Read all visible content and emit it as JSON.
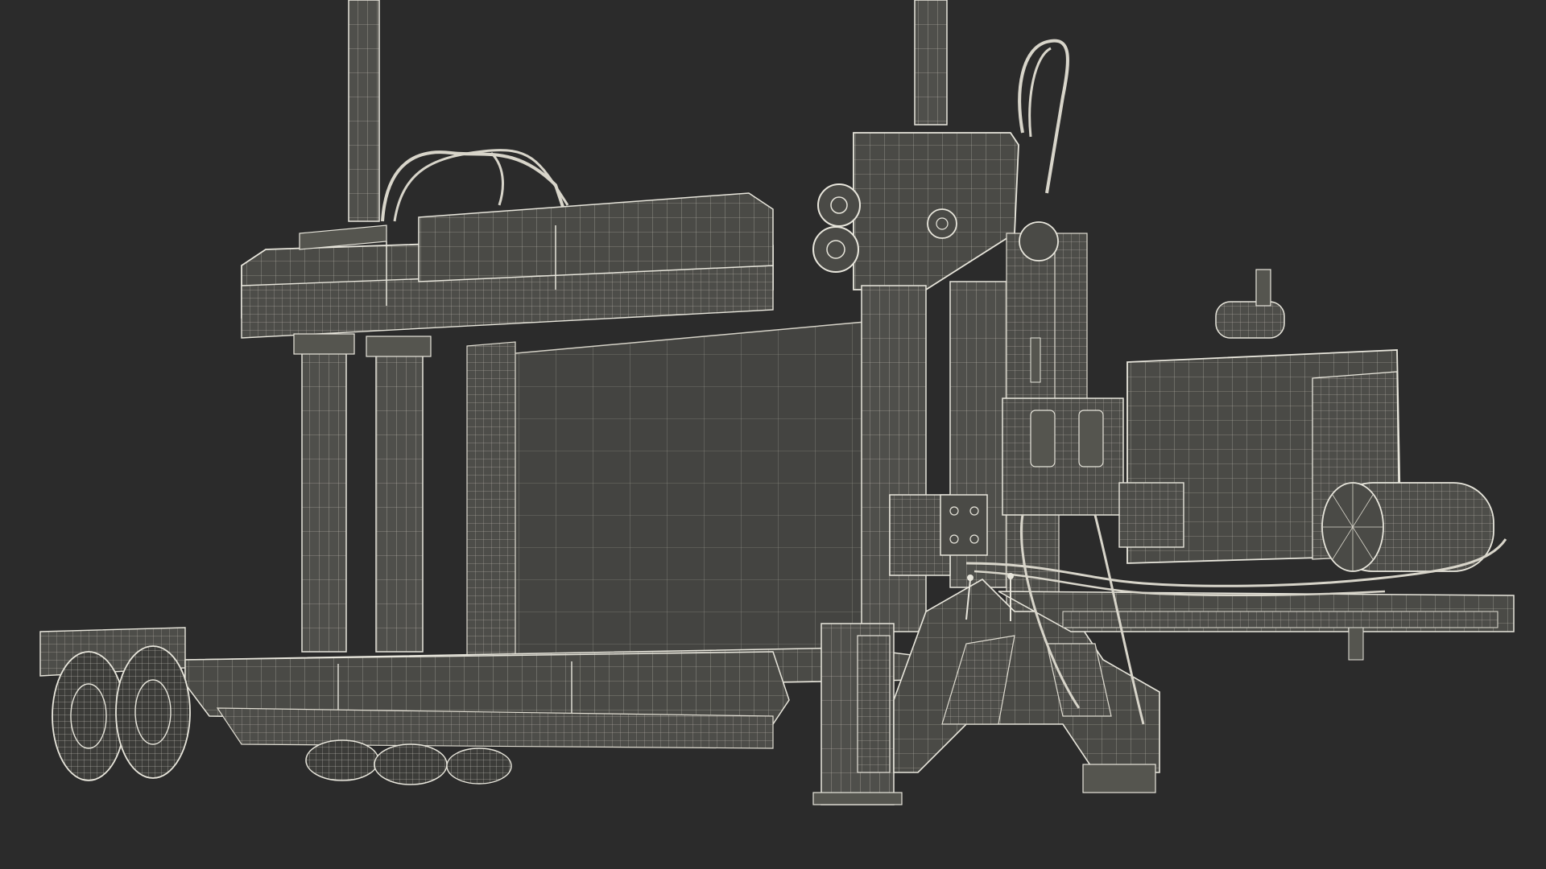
{
  "scene": {
    "background_color": "#2b2b2b",
    "wire_color": "#e8e6dc",
    "surface_color": "#4a4a46",
    "surface_dark": "#3e3e3b",
    "surface_light": "#5a5a55"
  }
}
